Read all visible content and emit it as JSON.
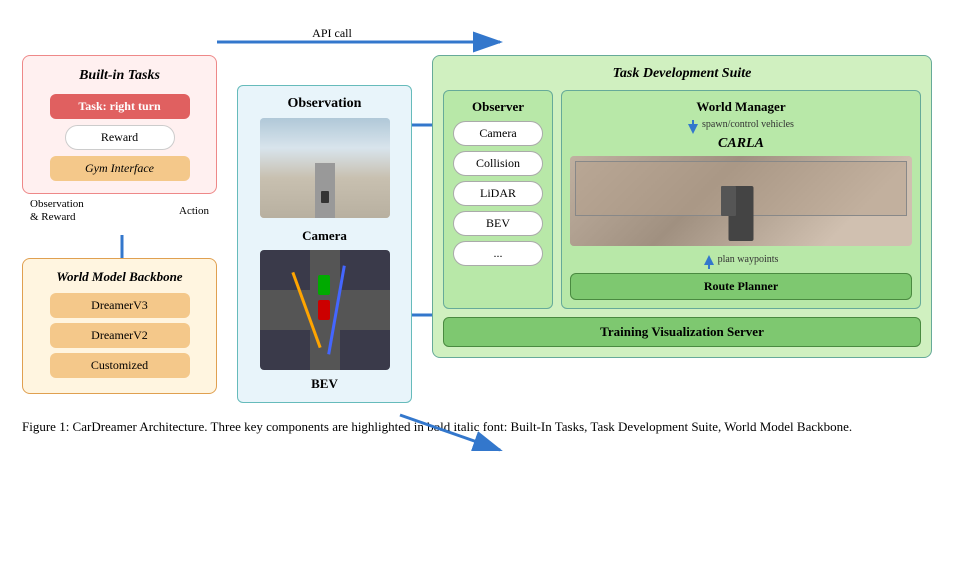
{
  "diagram": {
    "title": "Task Development Suite",
    "api_call_label": "API call",
    "built_in_tasks": {
      "title": "Built-in Tasks",
      "task_label": "Task: right turn",
      "reward_label": "Reward",
      "gym_interface_label": "Gym Interface"
    },
    "left_arrows": {
      "observation_reward_label": "Observation\n& Reward",
      "action_label": "Action"
    },
    "world_model": {
      "title": "World Model Backbone",
      "items": [
        "DreamerV3",
        "DreamerV2",
        "Customized"
      ]
    },
    "observation_section": {
      "observation_title": "Observation",
      "camera_title": "Camera",
      "bev_title": "BEV"
    },
    "observer": {
      "title": "Observer",
      "items": [
        "Camera",
        "Collision",
        "LiDAR",
        "BEV",
        "..."
      ]
    },
    "world_manager": {
      "title": "World Manager",
      "spawn_label": "spawn/control vehicles",
      "carla_title": "CARLA",
      "plan_label": "plan waypoints",
      "route_planner_label": "Route Planner"
    },
    "training_vis": {
      "label": "Training Visualization Server"
    }
  },
  "caption": {
    "text": "Figure 1: CarDreamer Architecture. Three key components are highlighted in bold italic font: Built-In Tasks, Task Development Suite, World Model Backbone."
  }
}
